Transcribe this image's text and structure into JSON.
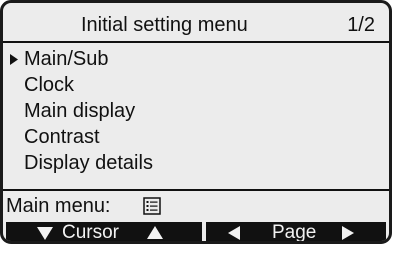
{
  "header": {
    "title": "Initial setting menu",
    "page": "1/2"
  },
  "menu": {
    "selected_index": 0,
    "items": [
      {
        "label": "Main/Sub"
      },
      {
        "label": "Clock"
      },
      {
        "label": "Main display"
      },
      {
        "label": "Contrast"
      },
      {
        "label": "Display details"
      }
    ]
  },
  "footer": {
    "label": "Main menu:",
    "icon": "menu-list-icon"
  },
  "softkeys": {
    "left": {
      "label": "Cursor",
      "icons": [
        "triangle-down-icon",
        "triangle-up-icon"
      ]
    },
    "right": {
      "label": "Page",
      "icons": [
        "triangle-left-icon",
        "triangle-right-icon"
      ]
    }
  },
  "colors": {
    "screen_bg": "#ececec",
    "ink": "#111111",
    "softkey_text": "#f2f2f2"
  }
}
